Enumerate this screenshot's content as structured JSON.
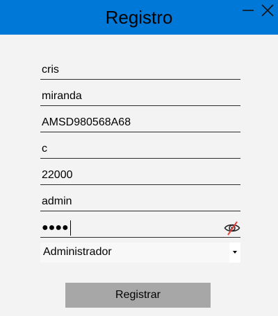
{
  "window": {
    "title": "Registro",
    "titlebar_color": "#0078d7",
    "minimize_icon": "minimize-icon",
    "close_icon": "close-icon"
  },
  "form": {
    "fields": [
      {
        "name": "nombre",
        "value": "cris"
      },
      {
        "name": "apellido",
        "value": "miranda"
      },
      {
        "name": "curp",
        "value": "AMSD980568A68"
      },
      {
        "name": "campo-4",
        "value": "c"
      },
      {
        "name": "codigo-postal",
        "value": "22000"
      },
      {
        "name": "usuario",
        "value": "admin"
      }
    ],
    "password": {
      "masked_value": "●●●●",
      "toggle_icon": "eye-slash-icon"
    },
    "role_select": {
      "selected": "Administrador",
      "arrow_icon": "dropdown-arrow-icon"
    },
    "submit_label": "Registrar",
    "submit_color": "#a7a7a7"
  }
}
